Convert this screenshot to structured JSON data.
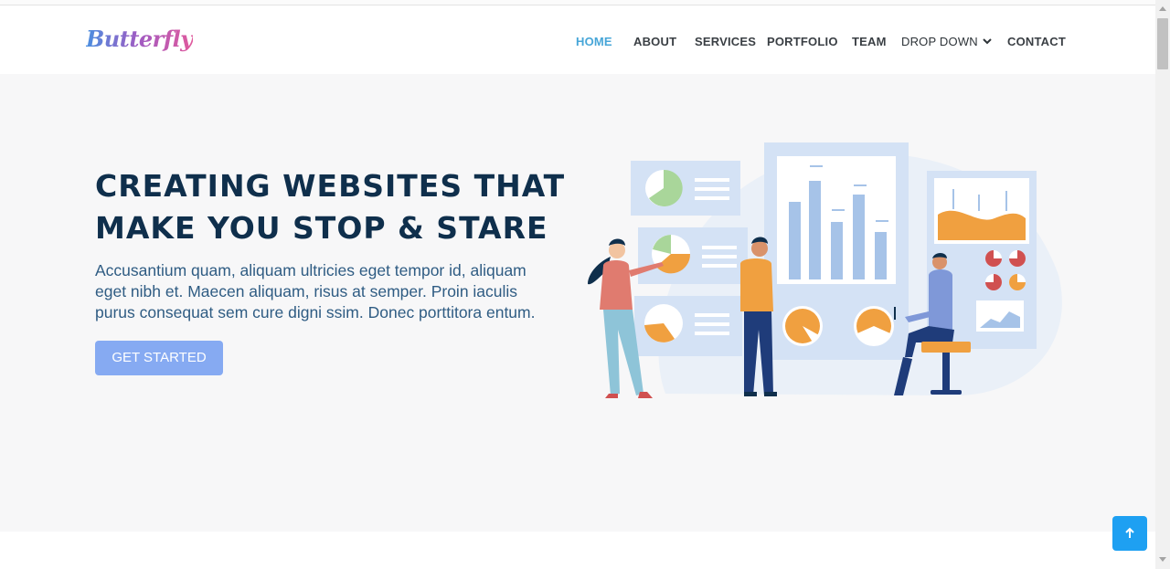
{
  "brand": {
    "logo_text": "Butterfly"
  },
  "nav": {
    "items": [
      {
        "label": "HOME",
        "active": true
      },
      {
        "label": "ABOUT"
      },
      {
        "label": "SERVICES"
      },
      {
        "label": "PORTFOLIO"
      },
      {
        "label": "TEAM"
      },
      {
        "label": "DROP DOWN",
        "has_dropdown": true
      },
      {
        "label": "CONTACT"
      }
    ],
    "dropdown_icon": "chevron-down-icon"
  },
  "hero": {
    "headline_line1": "CREATING WEBSITES THAT",
    "headline_line2": "MAKE YOU STOP & STARE",
    "subtext": "Accusantium quam, aliquam ultricies eget tempor id, aliquam eget nibh et. Maecen aliquam, risus at semper. Proin iaculis purus consequat sem cure digni ssim. Donec porttitora entum.",
    "cta_label": "GET STARTED"
  },
  "back_to_top": {
    "icon": "arrow-up-icon"
  },
  "colors": {
    "accent": "#47a6d8",
    "headline": "#0f2f4c",
    "subtext": "#2f5c83",
    "cta_bg": "#86aaf2",
    "back_to_top_bg": "#1ea0f2",
    "hero_bg": "#f7f7f8"
  }
}
